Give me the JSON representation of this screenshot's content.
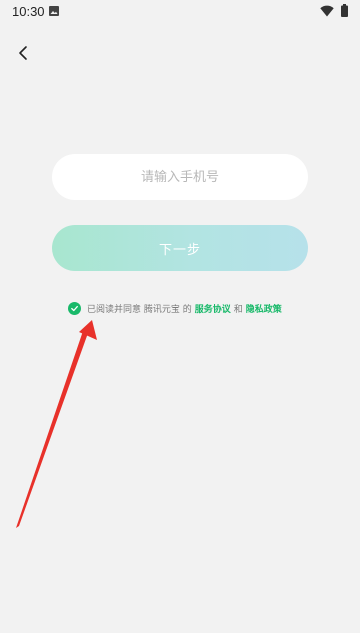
{
  "status_bar": {
    "time": "10:30",
    "icons": [
      "photo-icon",
      "wifi-icon",
      "battery-icon"
    ]
  },
  "header": {
    "back_icon": "chevron-left-icon"
  },
  "form": {
    "phone_placeholder": "请输入手机号",
    "phone_value": "",
    "next_label": "下一步"
  },
  "agreement": {
    "checked": true,
    "prefix": "已阅读并同意 腾讯元宝 的",
    "service_link": "服务协议",
    "conjunction": "和",
    "privacy_link": "隐私政策"
  },
  "annotation": {
    "type": "arrow",
    "color": "#e8312a"
  },
  "colors": {
    "background": "#f2f2f2",
    "accent": "#19b96a",
    "button_gradient_start": "#a8e6cf",
    "button_gradient_end": "#b6e1ea"
  }
}
